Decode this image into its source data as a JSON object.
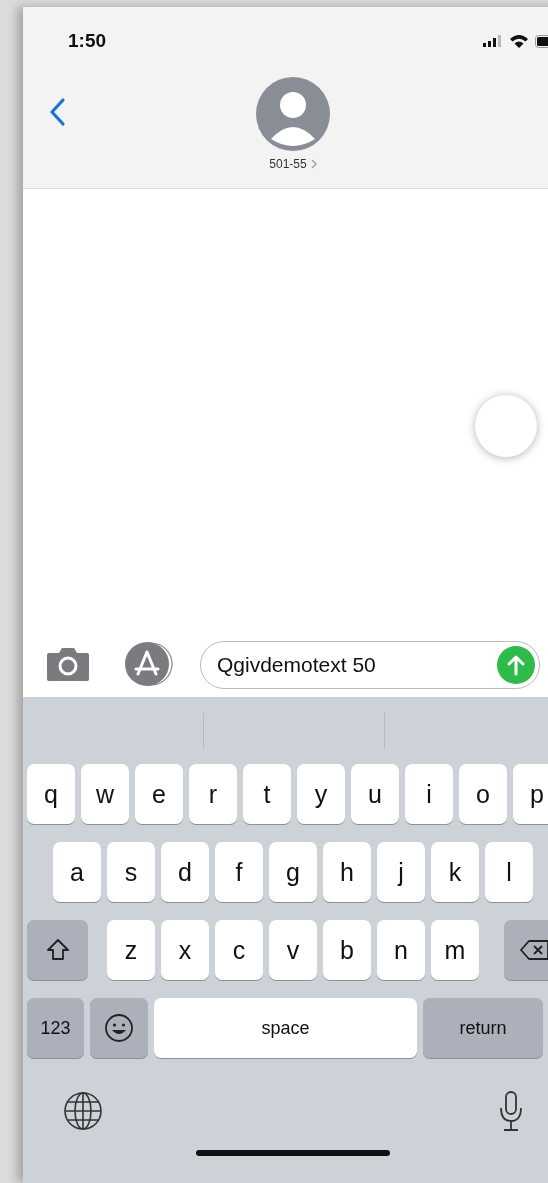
{
  "status_bar": {
    "time": "1:50"
  },
  "contact": {
    "name": "501-55"
  },
  "compose": {
    "value": "Qgivdemotext 50"
  },
  "keyboard": {
    "rows": [
      {
        "keys": [
          {
            "kind": "letter",
            "label": "q"
          },
          {
            "kind": "letter",
            "label": "w"
          },
          {
            "kind": "letter",
            "label": "e"
          },
          {
            "kind": "letter",
            "label": "r"
          },
          {
            "kind": "letter",
            "label": "t"
          },
          {
            "kind": "letter",
            "label": "y"
          },
          {
            "kind": "letter",
            "label": "u"
          },
          {
            "kind": "letter",
            "label": "i"
          },
          {
            "kind": "letter",
            "label": "o"
          },
          {
            "kind": "letter",
            "label": "p"
          }
        ]
      },
      {
        "keys": [
          {
            "kind": "letter",
            "label": "a"
          },
          {
            "kind": "letter",
            "label": "s"
          },
          {
            "kind": "letter",
            "label": "d"
          },
          {
            "kind": "letter",
            "label": "f"
          },
          {
            "kind": "letter",
            "label": "g"
          },
          {
            "kind": "letter",
            "label": "h"
          },
          {
            "kind": "letter",
            "label": "j"
          },
          {
            "kind": "letter",
            "label": "k"
          },
          {
            "kind": "letter",
            "label": "l"
          }
        ]
      },
      {
        "keys": [
          {
            "kind": "shift"
          },
          {
            "kind": "letter",
            "label": "z"
          },
          {
            "kind": "letter",
            "label": "x"
          },
          {
            "kind": "letter",
            "label": "c"
          },
          {
            "kind": "letter",
            "label": "v"
          },
          {
            "kind": "letter",
            "label": "b"
          },
          {
            "kind": "letter",
            "label": "n"
          },
          {
            "kind": "letter",
            "label": "m"
          },
          {
            "kind": "delete"
          }
        ]
      },
      {
        "keys": [
          {
            "kind": "numbers",
            "label": "123"
          },
          {
            "kind": "emoji"
          },
          {
            "kind": "space",
            "label": "space"
          },
          {
            "kind": "return",
            "label": "return"
          }
        ]
      }
    ]
  }
}
